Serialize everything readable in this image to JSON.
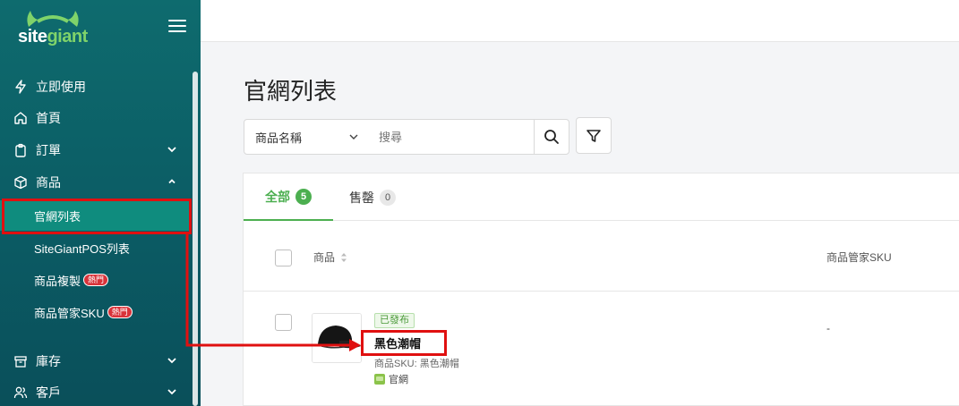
{
  "brand": {
    "name_part1": "site",
    "name_part2": "giant",
    "accent": "#7fd36a"
  },
  "sidebar": {
    "items": [
      {
        "label": "立即使用",
        "icon": "lightning-icon"
      },
      {
        "label": "首頁",
        "icon": "home-icon"
      },
      {
        "label": "訂單",
        "icon": "clipboard-icon",
        "expandable": true
      },
      {
        "label": "商品",
        "icon": "box-icon",
        "expanded": true
      },
      {
        "label": "庫存",
        "icon": "archive-icon",
        "expandable": true
      },
      {
        "label": "客戶",
        "icon": "users-icon",
        "expandable": true
      }
    ],
    "subitems": [
      {
        "label": "官網列表",
        "active": true
      },
      {
        "label": "SiteGiantPOS列表"
      },
      {
        "label": "商品複製",
        "badge": "熱門"
      },
      {
        "label": "商品管家SKU",
        "badge": "熱門"
      }
    ]
  },
  "main": {
    "title": "官網列表",
    "filter": {
      "selected": "商品名稱",
      "search_placeholder": "搜尋"
    },
    "tabs": [
      {
        "label": "全部",
        "count": "5",
        "active": true
      },
      {
        "label": "售罄",
        "count": "0"
      }
    ],
    "columns": {
      "product": "商品",
      "sku": "商品管家SKU"
    },
    "rows": [
      {
        "status": "已發布",
        "name": "黑色潮帽",
        "sku_line": "商品SKU: 黑色潮帽",
        "channel": "官網",
        "manager_sku": "-"
      }
    ]
  },
  "colors": {
    "sidebar": "#0b5a63",
    "active_item": "#0f8c7e",
    "accent_green": "#4caf50",
    "annotation_red": "#e01010",
    "hot_badge": "#d9333a"
  }
}
